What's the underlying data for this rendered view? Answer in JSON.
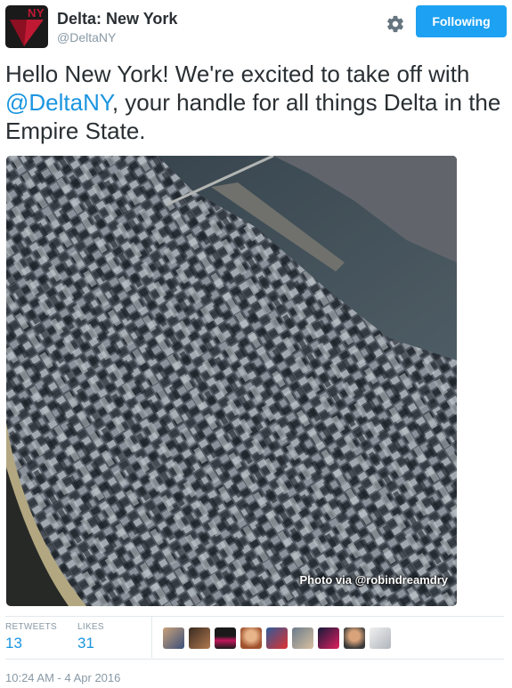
{
  "user": {
    "name": "Delta: New York",
    "handle": "@DeltaNY",
    "avatar_badge": "NY",
    "avatar_icon": "delta-widget-logo"
  },
  "actions": {
    "settings_icon": "gear-icon",
    "follow_label": "Following"
  },
  "tweet": {
    "text_before": "Hello New York! We're excited to take off with ",
    "mention": "@DeltaNY",
    "text_after": ", your handle for all things Delta in the Empire State."
  },
  "photo": {
    "subject": "aerial view of Manhattan",
    "credit": "Photo via @robindreamdry"
  },
  "stats": {
    "retweets_label": "RETWEETS",
    "retweets_value": "13",
    "likes_label": "LIKES",
    "likes_value": "31"
  },
  "likers_count_shown": 9,
  "timestamp": "10:24 AM - 4 Apr 2016",
  "colors": {
    "brand_blue": "#1da1f2",
    "link_blue": "#1b95e0",
    "delta_red": "#c01933",
    "muted_gray": "#8899a6"
  }
}
